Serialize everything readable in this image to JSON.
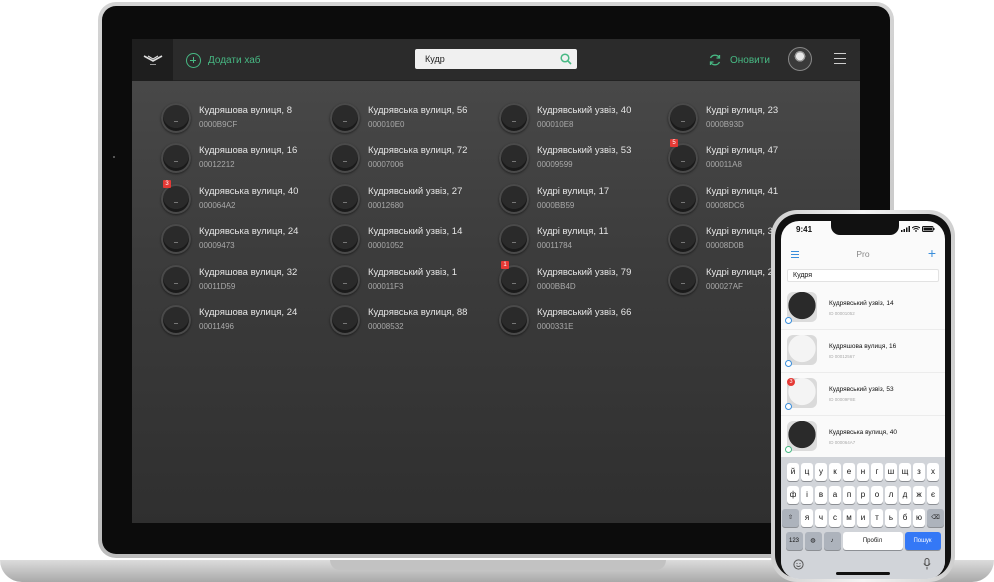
{
  "laptop": {
    "toolbar": {
      "add_hub_label": "Додати хаб",
      "search_value": "Кудр",
      "refresh_label": "Оновити"
    },
    "hubs": [
      {
        "name": "Кудряшова вулиця, 8",
        "id": "0000B9CF",
        "badge": ""
      },
      {
        "name": "Кудрявська вулиця, 56",
        "id": "000010E0",
        "badge": ""
      },
      {
        "name": "Кудрявський узвіз, 40",
        "id": "000010E8",
        "badge": ""
      },
      {
        "name": "Кудрі вулиця, 23",
        "id": "0000B93D",
        "badge": ""
      },
      {
        "name": "Кудряшова вулиця, 16",
        "id": "00012212",
        "badge": ""
      },
      {
        "name": "Кудрявська вулиця, 72",
        "id": "00007006",
        "badge": ""
      },
      {
        "name": "Кудрявський узвіз, 53",
        "id": "00009599",
        "badge": ""
      },
      {
        "name": "Кудрі вулиця, 47",
        "id": "000011A8",
        "badge": "5"
      },
      {
        "name": "Кудрявська вулиця, 40",
        "id": "000064A2",
        "badge": "3"
      },
      {
        "name": "Кудрявський узвіз, 27",
        "id": "00012680",
        "badge": ""
      },
      {
        "name": "Кудрі вулиця, 17",
        "id": "0000BB59",
        "badge": ""
      },
      {
        "name": "Кудрі вулиця, 41",
        "id": "00008DC6",
        "badge": ""
      },
      {
        "name": "Кудрявська вулиця, 24",
        "id": "00009473",
        "badge": ""
      },
      {
        "name": "Кудрявський узвіз, 14",
        "id": "00001052",
        "badge": ""
      },
      {
        "name": "Кудрі вулиця, 11",
        "id": "00011784",
        "badge": ""
      },
      {
        "name": "Кудрі вулиця, 3",
        "id": "00008D0B",
        "badge": ""
      },
      {
        "name": "Кудряшова вулиця, 32",
        "id": "00011D59",
        "badge": ""
      },
      {
        "name": "Кудрявський узвіз, 1",
        "id": "000011F3",
        "badge": ""
      },
      {
        "name": "Кудрявський узвіз, 79",
        "id": "0000BB4D",
        "badge": "1"
      },
      {
        "name": "Кудрі вулиця, 2",
        "id": "000027AF",
        "badge": ""
      },
      {
        "name": "Кудряшова вулиця, 24",
        "id": "00011496",
        "badge": ""
      },
      {
        "name": "Кудрявська вулиця, 88",
        "id": "00008532",
        "badge": ""
      },
      {
        "name": "Кудрявський узвіз, 66",
        "id": "0000331E",
        "badge": ""
      }
    ]
  },
  "phone": {
    "time": "9:41",
    "title": "Pro",
    "search_value": "Кудря",
    "items": [
      {
        "name": "Кудрявський узвіз, 14",
        "id": "ID 00001052",
        "color": "dark",
        "badge": "",
        "dot": "blue"
      },
      {
        "name": "Кудряшова вулиця, 16",
        "id": "ID 00012567",
        "color": "white",
        "badge": "",
        "dot": "blue"
      },
      {
        "name": "Кудрявський узвіз, 53",
        "id": "ID 00009F8E",
        "color": "white",
        "badge": "3",
        "dot": "blue"
      },
      {
        "name": "Кудрявська вулиця, 40",
        "id": "ID 000064A7",
        "color": "dark",
        "badge": "",
        "dot": "green"
      }
    ],
    "keyboard": {
      "row1": [
        "й",
        "ц",
        "у",
        "к",
        "е",
        "н",
        "г",
        "ш",
        "щ",
        "з",
        "х"
      ],
      "row2": [
        "ф",
        "і",
        "в",
        "а",
        "п",
        "р",
        "о",
        "л",
        "д",
        "ж",
        "є"
      ],
      "row3": [
        "я",
        "ч",
        "с",
        "м",
        "и",
        "т",
        "ь",
        "б",
        "ю"
      ],
      "shift_label": "⇧",
      "backspace_label": "⌫",
      "numbers_label": "123",
      "space_label": "Пробіл",
      "search_label": "Пошук"
    }
  }
}
